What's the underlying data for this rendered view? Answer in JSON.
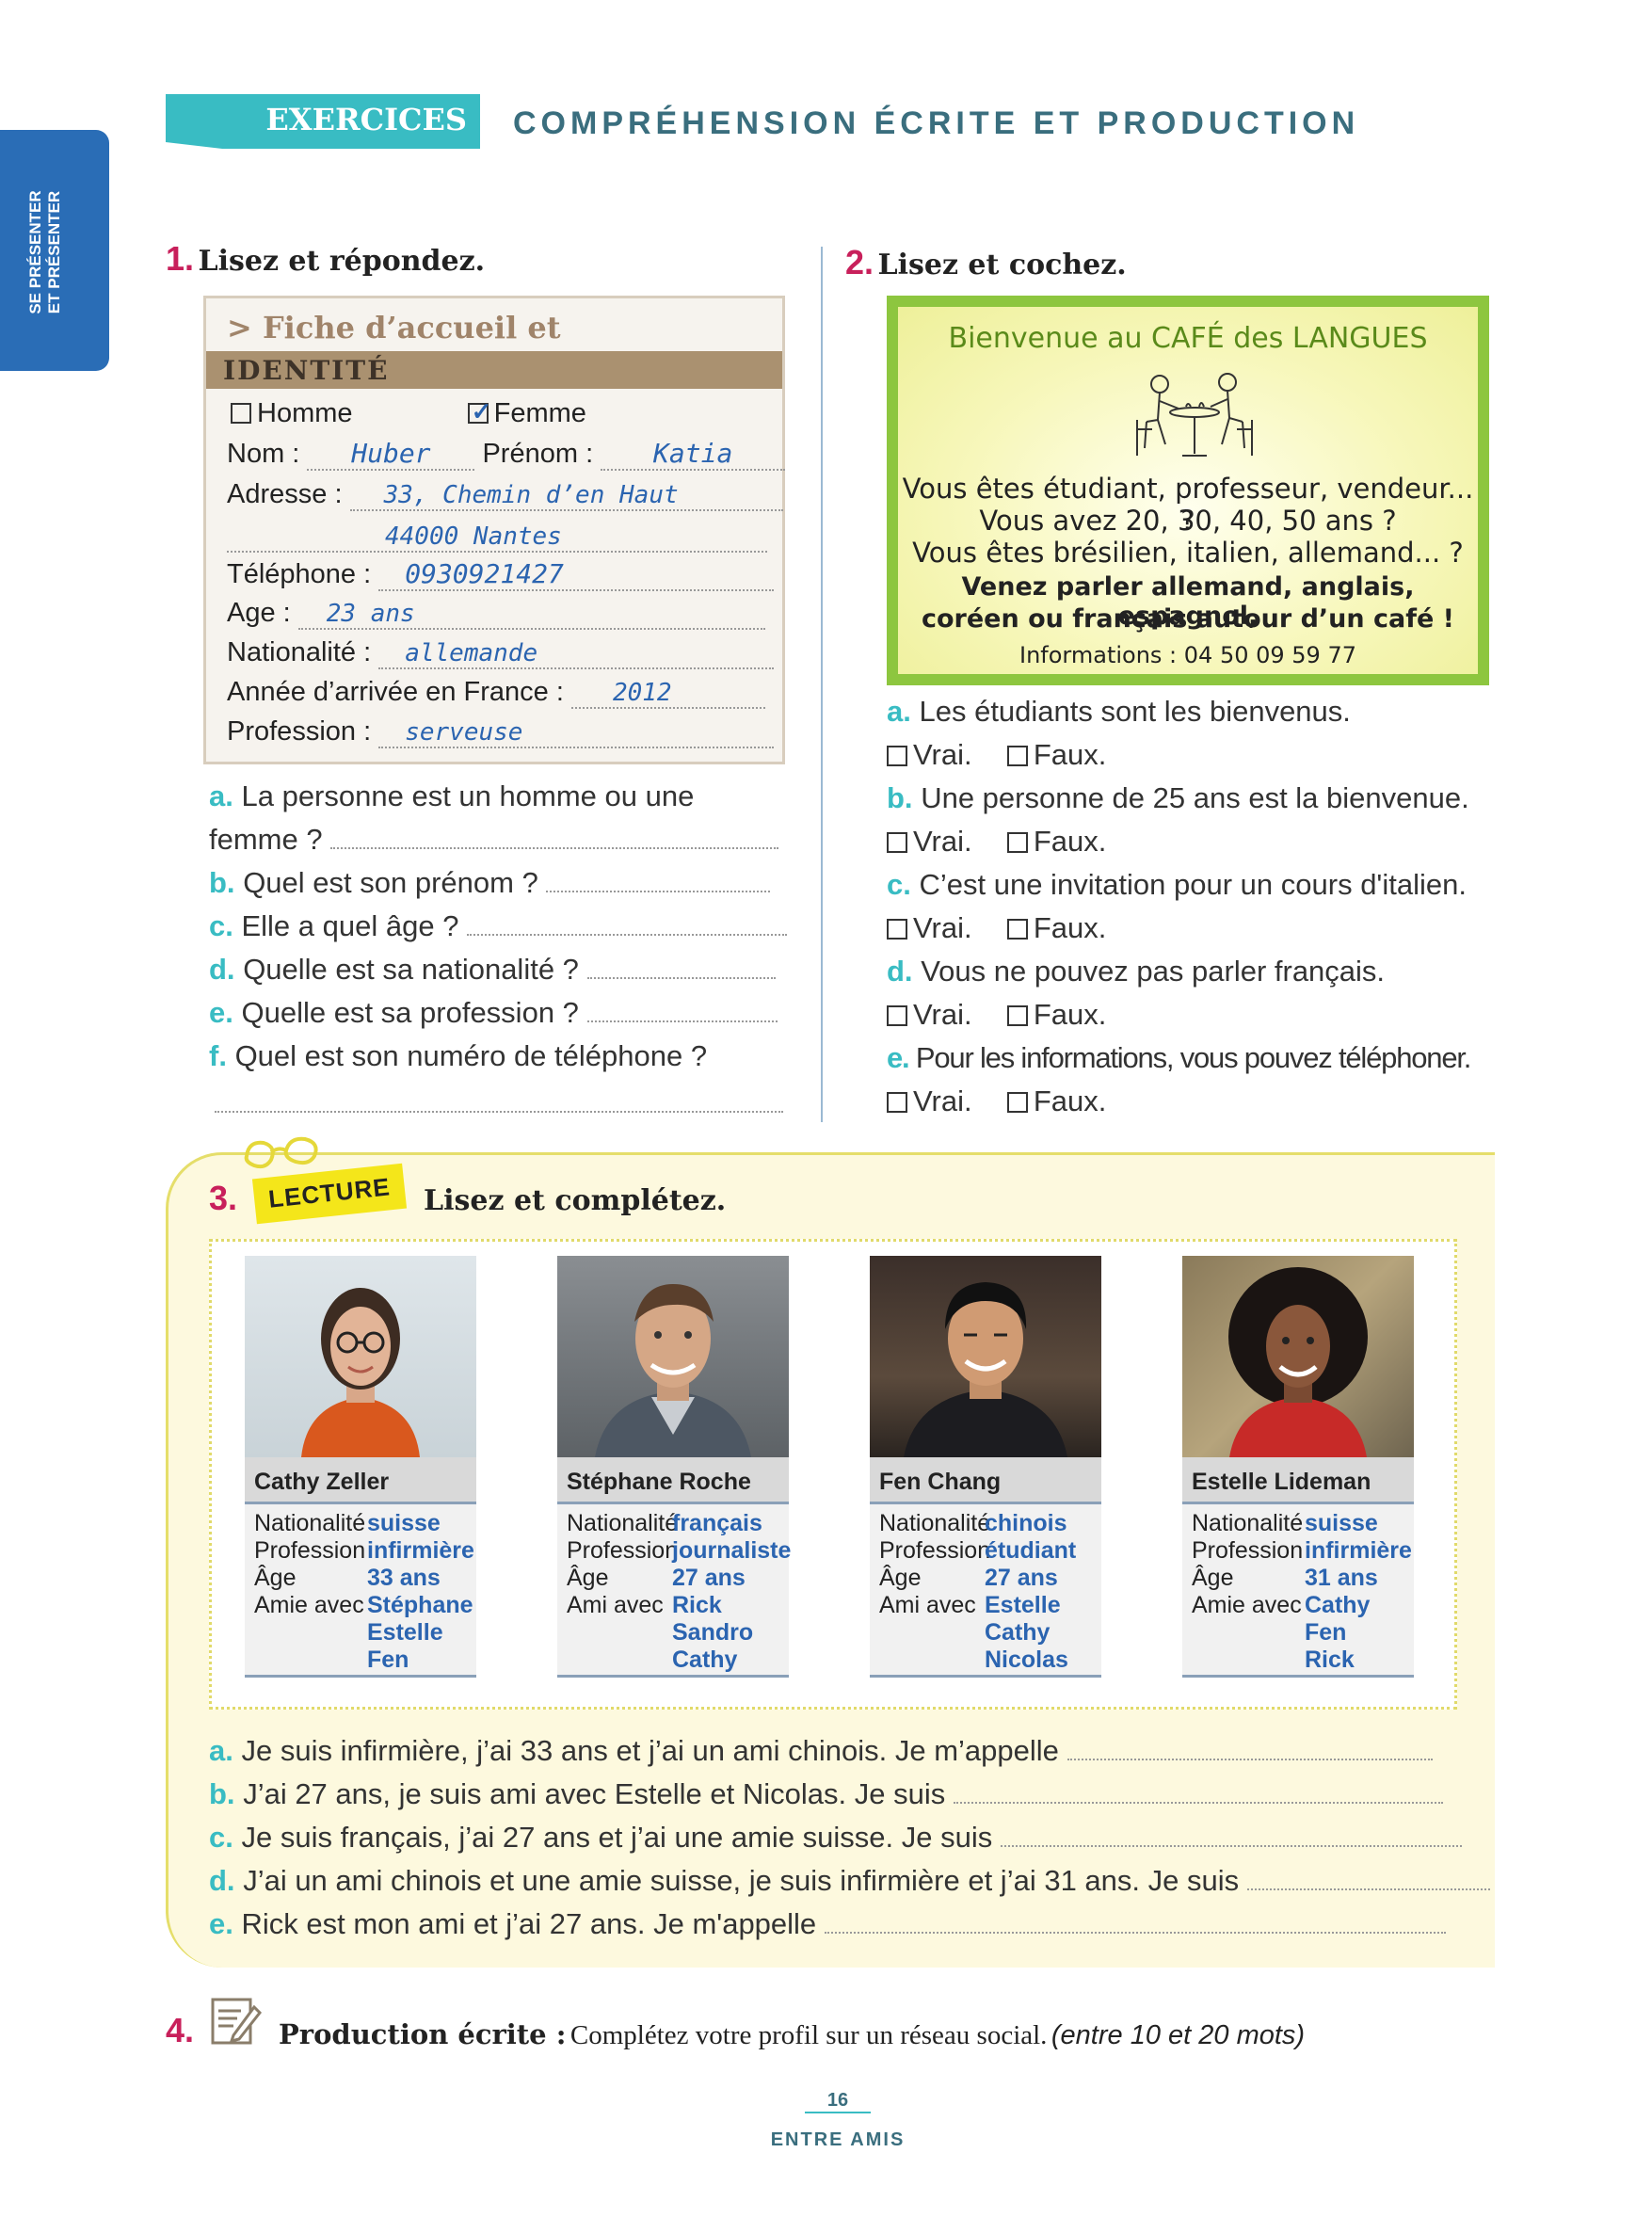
{
  "side_tab": "SE PRÉSENTER ET PRÉSENTER",
  "header": {
    "badge": "EXERCICES",
    "title": "COMPRÉHENSION ÉCRITE ET PRODUCTION"
  },
  "ex1": {
    "number": "1.",
    "title": "Lisez et répondez.",
    "fiche_title": "> Fiche d’accueil et d’orientation",
    "band": "IDENTITÉ",
    "homme": "Homme",
    "femme": "Femme",
    "nom_label": "Nom :",
    "nom_value": "Huber",
    "prenom_label": "Prénom :",
    "prenom_value": "Katia",
    "adresse_label": "Adresse :",
    "adresse_value1": "33, Chemin d’en Haut",
    "adresse_value2": "44000 Nantes",
    "telephone_label": "Téléphone :",
    "telephone_value": "0930921427",
    "age_label": "Age :",
    "age_value": "23 ans",
    "nationalite_label": "Nationalité :",
    "nationalite_value": "allemande",
    "annee_label": "Année d’arrivée en France :",
    "annee_value": "2012",
    "profession_label": "Profession :",
    "profession_value": "serveuse",
    "questions": [
      {
        "letter": "a.",
        "text": "La personne est un homme ou une",
        "text2": "femme ?"
      },
      {
        "letter": "b.",
        "text": "Quel est son prénom ?"
      },
      {
        "letter": "c.",
        "text": "Elle a quel âge ?"
      },
      {
        "letter": "d.",
        "text": "Quelle est sa nationalité ?"
      },
      {
        "letter": "e.",
        "text": "Quelle est sa profession ?"
      },
      {
        "letter": "f.",
        "text": "Quel est son numéro de téléphone ?"
      }
    ]
  },
  "ex2": {
    "number": "2.",
    "title": "Lisez et cochez.",
    "poster_title": "Bienvenue au CAFÉ des LANGUES",
    "poster_lines": [
      "Vous êtes étudiant, professeur, vendeur... ?",
      "Vous avez 20, 30, 40, 50 ans ?",
      "Vous êtes brésilien, italien, allemand... ?"
    ],
    "poster_bold1": "Venez parler allemand, anglais, espagnol,",
    "poster_bold2": "coréen ou français autour d’un café !",
    "poster_info": "Informations : 04 50 09 59 77",
    "vrai": "Vrai.",
    "faux": "Faux.",
    "statements": [
      {
        "letter": "a.",
        "text": "Les étudiants sont les bienvenus."
      },
      {
        "letter": "b.",
        "text": "Une personne de 25 ans est la bienvenue."
      },
      {
        "letter": "c.",
        "text": "C’est une invitation pour un cours d'italien."
      },
      {
        "letter": "d.",
        "text": "Vous ne pouvez pas parler français."
      },
      {
        "letter": "e.",
        "text": "Pour les informations, vous pouvez téléphoner."
      }
    ]
  },
  "ex3": {
    "number": "3.",
    "tag": "LECTURE",
    "title": "Lisez et complétez.",
    "labels": {
      "nationalite": "Nationalité",
      "profession": "Profession",
      "age": "Âge",
      "amie": "Amie avec",
      "ami": "Ami avec"
    },
    "cards": [
      {
        "name": "Cathy Zeller",
        "nationalite": "suisse",
        "profession": "infirmière",
        "age": "33 ans",
        "amis": [
          "Stéphane",
          "Estelle",
          "Fen"
        ],
        "ami_label": "Amie avec"
      },
      {
        "name": "Stéphane Roche",
        "nationalite": "français",
        "profession": "journaliste",
        "age": "27 ans",
        "amis": [
          "Rick",
          "Sandro",
          "Cathy"
        ],
        "ami_label": "Ami avec"
      },
      {
        "name": "Fen Chang",
        "nationalite": "chinois",
        "profession": "étudiant",
        "age": "27 ans",
        "amis": [
          "Estelle",
          "Cathy",
          "Nicolas"
        ],
        "ami_label": "Ami avec"
      },
      {
        "name": "Estelle Lideman",
        "nationalite": "suisse",
        "profession": "infirmière",
        "age": "31 ans",
        "amis": [
          "Cathy",
          "Fen",
          "Rick"
        ],
        "ami_label": "Amie avec"
      }
    ],
    "sentences": [
      {
        "letter": "a.",
        "text": "Je suis infirmière, j’ai 33 ans et j’ai un ami chinois. Je m’appelle"
      },
      {
        "letter": "b.",
        "text": "J’ai 27 ans, je suis ami avec Estelle et Nicolas. Je suis"
      },
      {
        "letter": "c.",
        "text": "Je suis français, j’ai 27 ans et j’ai une amie suisse. Je suis"
      },
      {
        "letter": "d.",
        "text": "J’ai un ami chinois et une amie suisse, je suis infirmière et j’ai 31 ans. Je suis"
      },
      {
        "letter": "e.",
        "text": "Rick est mon ami et j’ai 27 ans. Je m'appelle"
      }
    ]
  },
  "ex4": {
    "number": "4.",
    "title": "Production écrite :",
    "text": "Complétez votre profil sur un réseau social.",
    "note": "(entre 10 et 20 mots)"
  },
  "footer": {
    "page": "16",
    "brand": "ENTRE AMIS"
  },
  "colors": {
    "accent": "#39bcc3",
    "number": "#c8205b",
    "blue": "#2a6db6",
    "poster_green": "#8dc63f"
  }
}
